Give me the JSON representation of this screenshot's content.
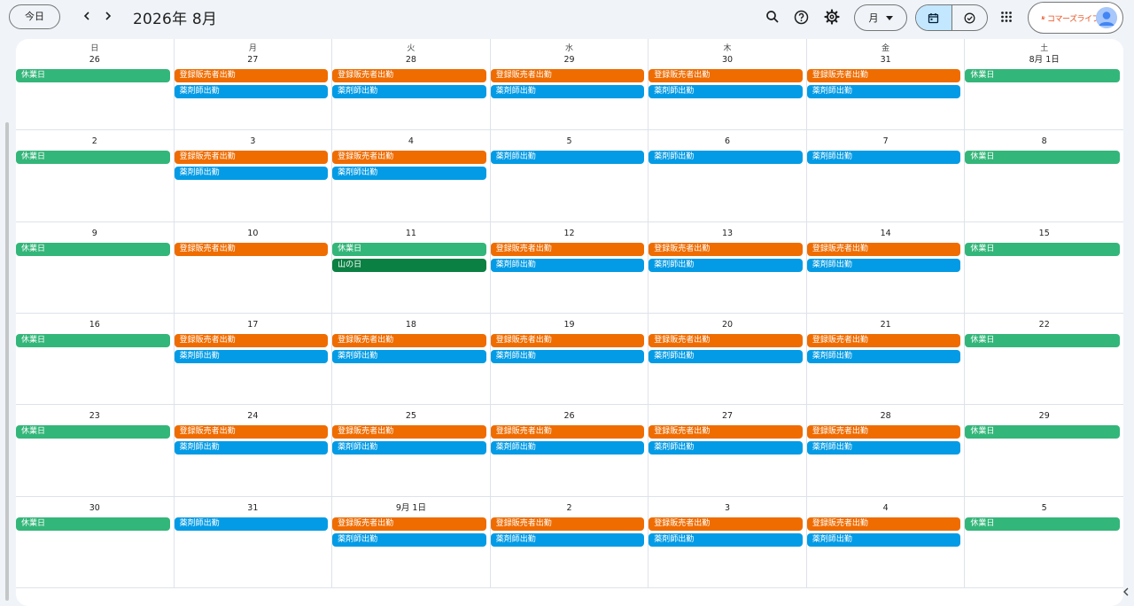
{
  "toolbar": {
    "today_label": "今日",
    "period_title": "2026年 8月",
    "view_label": "月",
    "brand_text": "コマーズライフ"
  },
  "colors": {
    "holiday": "#33b679",
    "seller": "#ef6c00",
    "pharmacist": "#039be5",
    "national_holiday": "#0b8043",
    "selected_view": "#c2e7ff"
  },
  "event_types": {
    "holiday": "休業日",
    "seller": "登録販売者出勤",
    "pharma": "薬剤師出勤",
    "mountain": "山の日"
  },
  "weekdays": [
    "日",
    "月",
    "火",
    "水",
    "木",
    "金",
    "土"
  ],
  "days": [
    {
      "date": "26",
      "events": [
        "holiday"
      ]
    },
    {
      "date": "27",
      "events": [
        "seller",
        "pharma"
      ]
    },
    {
      "date": "28",
      "events": [
        "seller",
        "pharma"
      ]
    },
    {
      "date": "29",
      "events": [
        "seller",
        "pharma"
      ]
    },
    {
      "date": "30",
      "events": [
        "seller",
        "pharma"
      ]
    },
    {
      "date": "31",
      "events": [
        "seller",
        "pharma"
      ]
    },
    {
      "date": "8月 1日",
      "events": [
        "holiday"
      ]
    },
    {
      "date": "2",
      "events": [
        "holiday"
      ]
    },
    {
      "date": "3",
      "events": [
        "seller",
        "pharma"
      ]
    },
    {
      "date": "4",
      "events": [
        "seller",
        "pharma"
      ]
    },
    {
      "date": "5",
      "events": [
        "pharma"
      ]
    },
    {
      "date": "6",
      "events": [
        "pharma"
      ]
    },
    {
      "date": "7",
      "events": [
        "pharma"
      ]
    },
    {
      "date": "8",
      "events": [
        "holiday"
      ]
    },
    {
      "date": "9",
      "events": [
        "holiday"
      ]
    },
    {
      "date": "10",
      "events": [
        "seller"
      ]
    },
    {
      "date": "11",
      "events": [
        "holiday",
        "mountain"
      ]
    },
    {
      "date": "12",
      "events": [
        "seller",
        "pharma"
      ]
    },
    {
      "date": "13",
      "events": [
        "seller",
        "pharma"
      ]
    },
    {
      "date": "14",
      "events": [
        "seller",
        "pharma"
      ]
    },
    {
      "date": "15",
      "events": [
        "holiday"
      ]
    },
    {
      "date": "16",
      "events": [
        "holiday"
      ]
    },
    {
      "date": "17",
      "events": [
        "seller",
        "pharma"
      ]
    },
    {
      "date": "18",
      "events": [
        "seller",
        "pharma"
      ]
    },
    {
      "date": "19",
      "events": [
        "seller",
        "pharma"
      ]
    },
    {
      "date": "20",
      "events": [
        "seller",
        "pharma"
      ]
    },
    {
      "date": "21",
      "events": [
        "seller",
        "pharma"
      ]
    },
    {
      "date": "22",
      "events": [
        "holiday"
      ]
    },
    {
      "date": "23",
      "events": [
        "holiday"
      ]
    },
    {
      "date": "24",
      "events": [
        "seller",
        "pharma"
      ]
    },
    {
      "date": "25",
      "events": [
        "seller",
        "pharma"
      ]
    },
    {
      "date": "26",
      "events": [
        "seller",
        "pharma"
      ]
    },
    {
      "date": "27",
      "events": [
        "seller",
        "pharma"
      ]
    },
    {
      "date": "28",
      "events": [
        "seller",
        "pharma"
      ]
    },
    {
      "date": "29",
      "events": [
        "holiday"
      ]
    },
    {
      "date": "30",
      "events": [
        "holiday"
      ]
    },
    {
      "date": "31",
      "events": [
        "pharma"
      ]
    },
    {
      "date": "9月 1日",
      "events": [
        "seller",
        "pharma"
      ]
    },
    {
      "date": "2",
      "events": [
        "seller",
        "pharma"
      ]
    },
    {
      "date": "3",
      "events": [
        "seller",
        "pharma"
      ]
    },
    {
      "date": "4",
      "events": [
        "seller",
        "pharma"
      ]
    },
    {
      "date": "5",
      "events": [
        "holiday"
      ]
    }
  ]
}
